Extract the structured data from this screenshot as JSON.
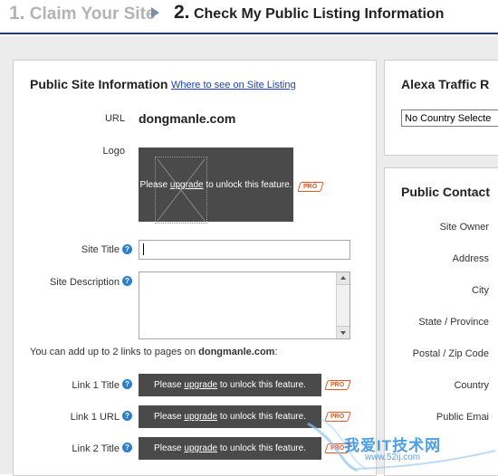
{
  "steps": {
    "step1_num": "1.",
    "step1_label": "Claim Your Site",
    "step2_num": "2.",
    "step2_label": "Check My Public Listing Information"
  },
  "public_site": {
    "title": "Public Site Information",
    "where_link": "Where to see on Site Listing",
    "url_label": "URL",
    "url_value": "dongmanle.com",
    "logo_label": "Logo",
    "site_title_label": "Site Title",
    "site_title_value": "",
    "site_description_label": "Site Description",
    "site_description_value": "",
    "links_intro_prefix": "You can add up to 2 links to pages on ",
    "links_intro_domain": "dongmanle.com",
    "links_intro_suffix": ":",
    "link1_title_label": "Link 1 Title",
    "link1_url_label": "Link 1 URL",
    "link2_title_label": "Link 2 Title"
  },
  "unlock": {
    "prefix": "Please ",
    "link": "upgrade",
    "suffix": " to unlock this feature.",
    "pro_badge": "PRO"
  },
  "alexa": {
    "title": "Alexa Traffic R",
    "country_select": "No Country Selecte"
  },
  "contact": {
    "title": "Public Contact",
    "fields": [
      "Site Owner",
      "Address",
      "City",
      "State / Province",
      "Postal / Zip Code",
      "Country",
      "Public Emai"
    ]
  },
  "watermark": {
    "text": "我爱IT技术网",
    "url": "www.52ij.com"
  },
  "colors": {
    "accent_link": "#1a3fbf",
    "step_divider": "#1f3a6b",
    "lock_bg": "#4a4a4a",
    "pro_orange": "#e8541c",
    "help_blue": "#2b7fd0"
  }
}
